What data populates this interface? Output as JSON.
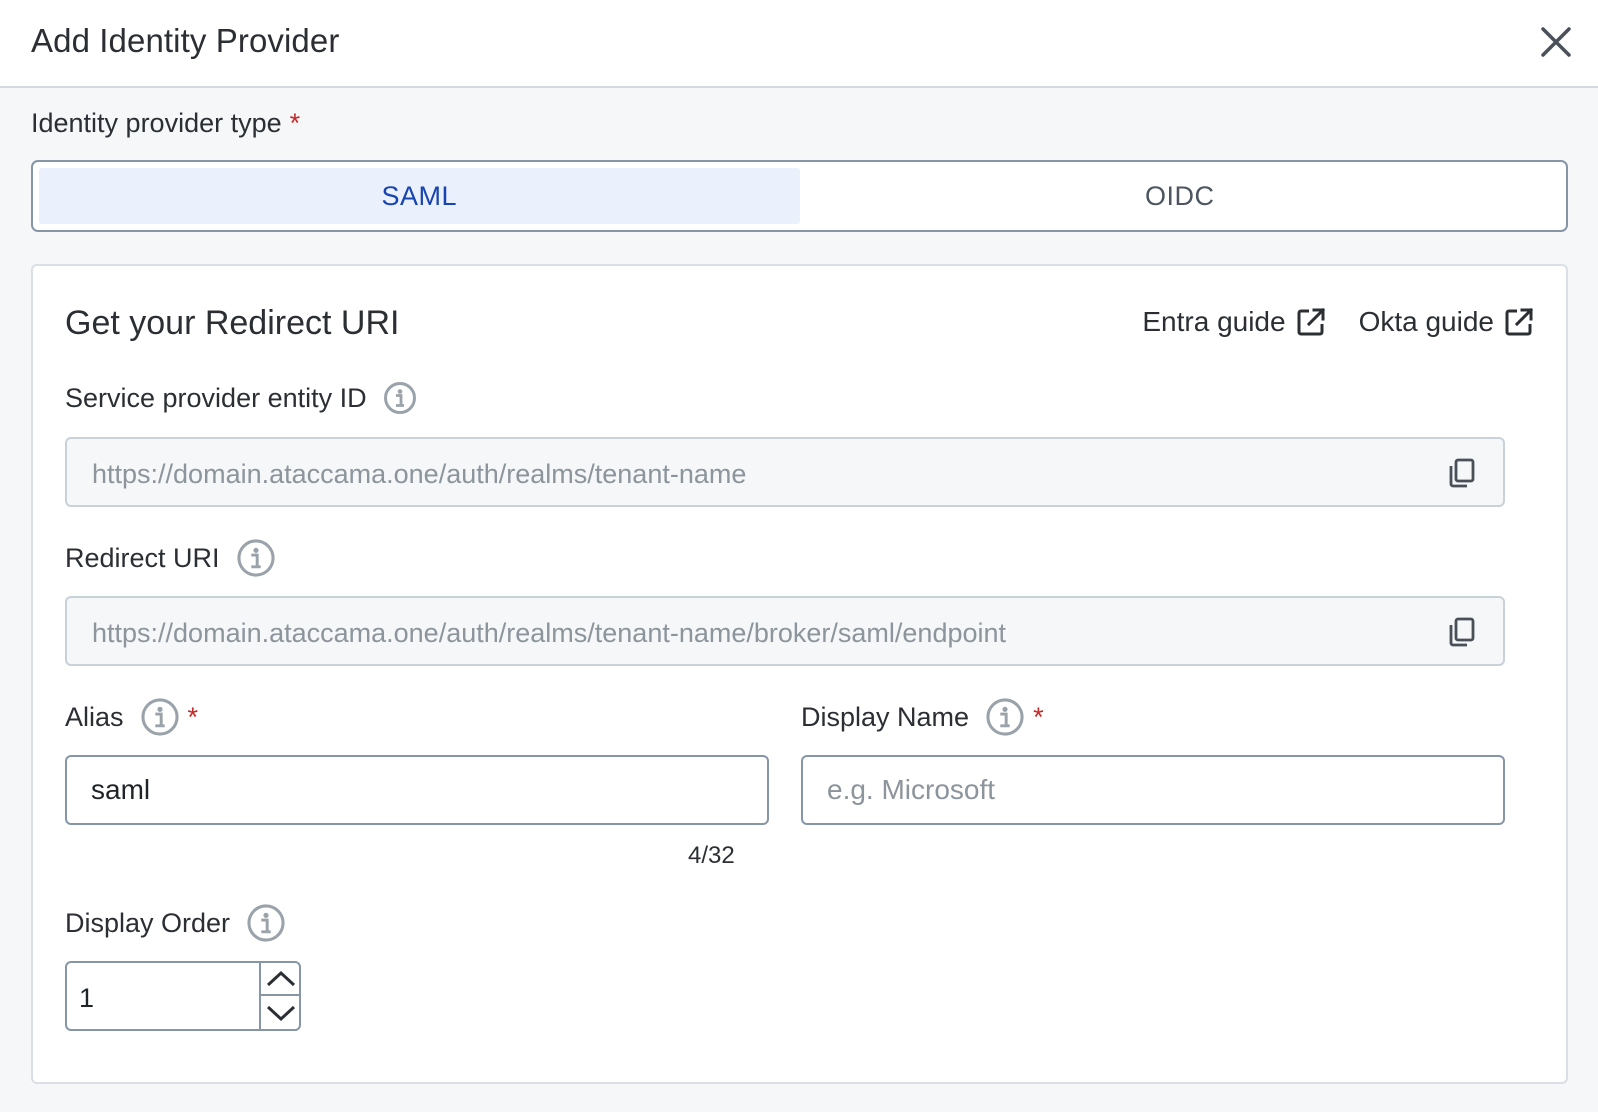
{
  "dialog": {
    "title": "Add Identity Provider",
    "close_icon": "close-icon"
  },
  "provider_type": {
    "label": "Identity provider type",
    "required_mark": "*",
    "options": [
      {
        "label": "SAML",
        "selected": true
      },
      {
        "label": "OIDC",
        "selected": false
      }
    ]
  },
  "redirect_section": {
    "title": "Get your Redirect URI",
    "guides": [
      {
        "label": "Entra guide",
        "icon": "external-link-icon"
      },
      {
        "label": "Okta guide",
        "icon": "external-link-icon"
      }
    ],
    "entity_id": {
      "label": "Service provider entity ID",
      "value": "https://domain.ataccama.one/auth/realms/tenant-name"
    },
    "redirect_uri": {
      "label": "Redirect URI",
      "value": "https://domain.ataccama.one/auth/realms/tenant-name/broker/saml/endpoint"
    },
    "alias": {
      "label": "Alias",
      "required_mark": "*",
      "value": "saml",
      "counter": "4/32"
    },
    "display_name": {
      "label": "Display Name",
      "required_mark": "*",
      "value": "",
      "placeholder": "e.g. Microsoft"
    },
    "display_order": {
      "label": "Display Order",
      "value": "1"
    }
  },
  "colors": {
    "accent": "#1744b0",
    "selected_bg": "#eaf0fc",
    "required": "#c62828",
    "border": "#8796a6"
  }
}
